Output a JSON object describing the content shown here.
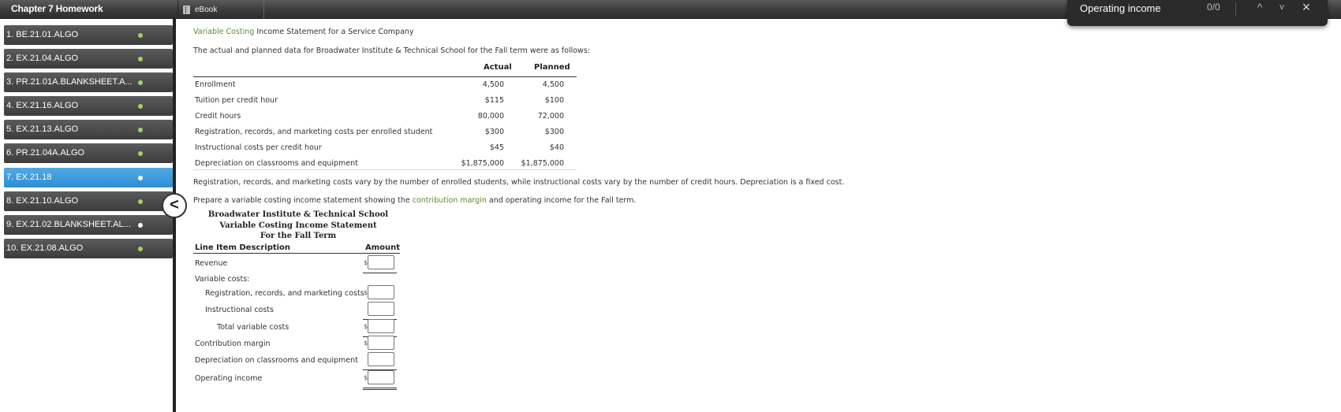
{
  "app": {
    "chapter_title": "Chapter 7 Homework",
    "ebook_label": "eBook"
  },
  "find_bar": {
    "query": "Operating income",
    "count": "0/0",
    "prev_glyph": "^",
    "next_glyph": "v",
    "close_glyph": "×"
  },
  "sidebar": {
    "collapse_glyph": "<",
    "items": [
      {
        "label": "1. BE.21.01.ALGO"
      },
      {
        "label": "2. EX.21.04.ALGO"
      },
      {
        "label": "3. PR.21.01A.BLANKSHEET.A..."
      },
      {
        "label": "4. EX.21.16.ALGO"
      },
      {
        "label": "5. EX.21.13.ALGO"
      },
      {
        "label": "6. PR.21.04A.ALGO"
      },
      {
        "label": "7. EX.21.18"
      },
      {
        "label": "8. EX.21.10.ALGO"
      },
      {
        "label": "9. EX.21.02.BLANKSHEET.AL..."
      },
      {
        "label": "10. EX.21.08.ALGO"
      }
    ]
  },
  "problem": {
    "title_link": "Variable Costing",
    "title_rest": " Income Statement for a Service Company",
    "intro": "The actual and planned data for Broadwater Institute & Technical School for the Fall term were as follows:",
    "col_actual": "Actual",
    "col_planned": "Planned",
    "rows": [
      {
        "label": "Enrollment",
        "actual": "4,500",
        "planned": "4,500"
      },
      {
        "label": "Tuition per credit hour",
        "actual": "$115",
        "planned": "$100"
      },
      {
        "label": "Credit hours",
        "actual": "80,000",
        "planned": "72,000"
      },
      {
        "label": "Registration, records, and marketing costs per enrolled student",
        "actual": "$300",
        "planned": "$300"
      },
      {
        "label": "Instructional costs per credit hour",
        "actual": "$45",
        "planned": "$40"
      },
      {
        "label": "Depreciation on classrooms and equipment",
        "actual": "$1,875,000",
        "planned": "$1,875,000"
      }
    ],
    "note": "Registration, records, and marketing costs vary by the number of enrolled students, while instructional costs vary by the number of credit hours. Depreciation is a fixed cost.",
    "instr_pre": "Prepare a variable costing income statement showing the ",
    "instr_link": "contribution margin",
    "instr_post": " and operating income for the Fall term."
  },
  "statement": {
    "head1": "Broadwater Institute & Technical School",
    "head2": "Variable Costing Income Statement",
    "head3": "For the Fall Term",
    "col_desc": "Line Item Description",
    "col_amount": "Amount",
    "dollar_sign": "$",
    "lines": {
      "revenue": "Revenue",
      "variable_costs": "Variable costs:",
      "registration": "Registration, records, and marketing costs",
      "instructional": "Instructional costs",
      "total_variable": "Total variable costs",
      "contribution": "Contribution margin",
      "depreciation": "Depreciation on classrooms and equipment",
      "operating": "Operating income"
    },
    "values": {
      "revenue": "",
      "registration": "",
      "instructional": "",
      "total_variable": "",
      "contribution": "",
      "depreciation": "",
      "operating": ""
    }
  }
}
